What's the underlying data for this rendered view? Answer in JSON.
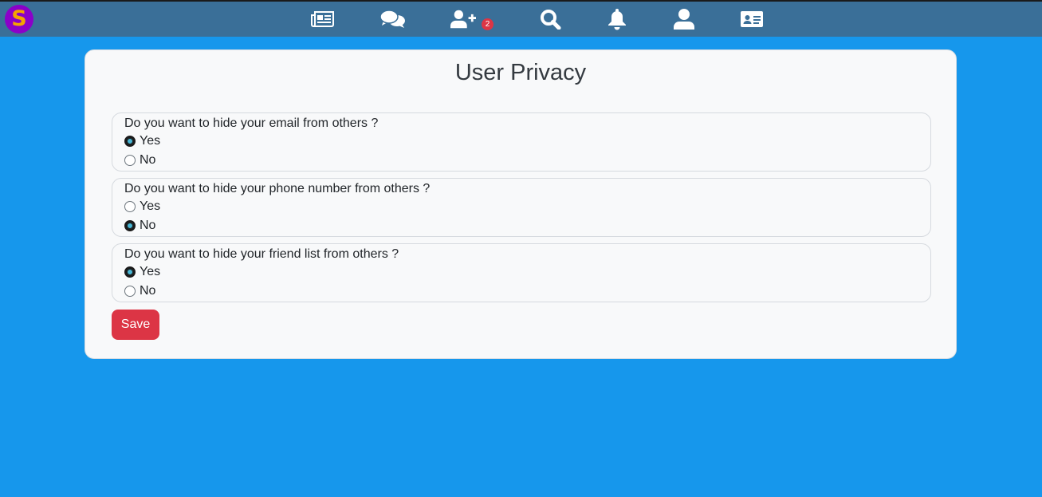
{
  "nav": {
    "logo_letter": "S",
    "icons": [
      "newspaper-icon",
      "comments-icon",
      "user-plus-icon",
      "search-icon",
      "bell-icon",
      "user-icon",
      "id-card-icon"
    ],
    "friend_request_count": "2"
  },
  "page": {
    "title": "User Privacy"
  },
  "questions": [
    {
      "label": "Do you want to hide your email from others ?",
      "options": [
        "Yes",
        "No"
      ],
      "selected": "Yes"
    },
    {
      "label": "Do you want to hide your phone number from others ?",
      "options": [
        "Yes",
        "No"
      ],
      "selected": "No"
    },
    {
      "label": "Do you want to hide your friend list from others ?",
      "options": [
        "Yes",
        "No"
      ],
      "selected": "Yes"
    }
  ],
  "actions": {
    "save_label": "Save"
  },
  "colors": {
    "background": "#1697ec",
    "topbar": "#3a6f98",
    "save_button": "#dc3545",
    "badge": "#dc3545",
    "logo_bg": "#8b00c9",
    "logo_letter": "#f5a300"
  }
}
